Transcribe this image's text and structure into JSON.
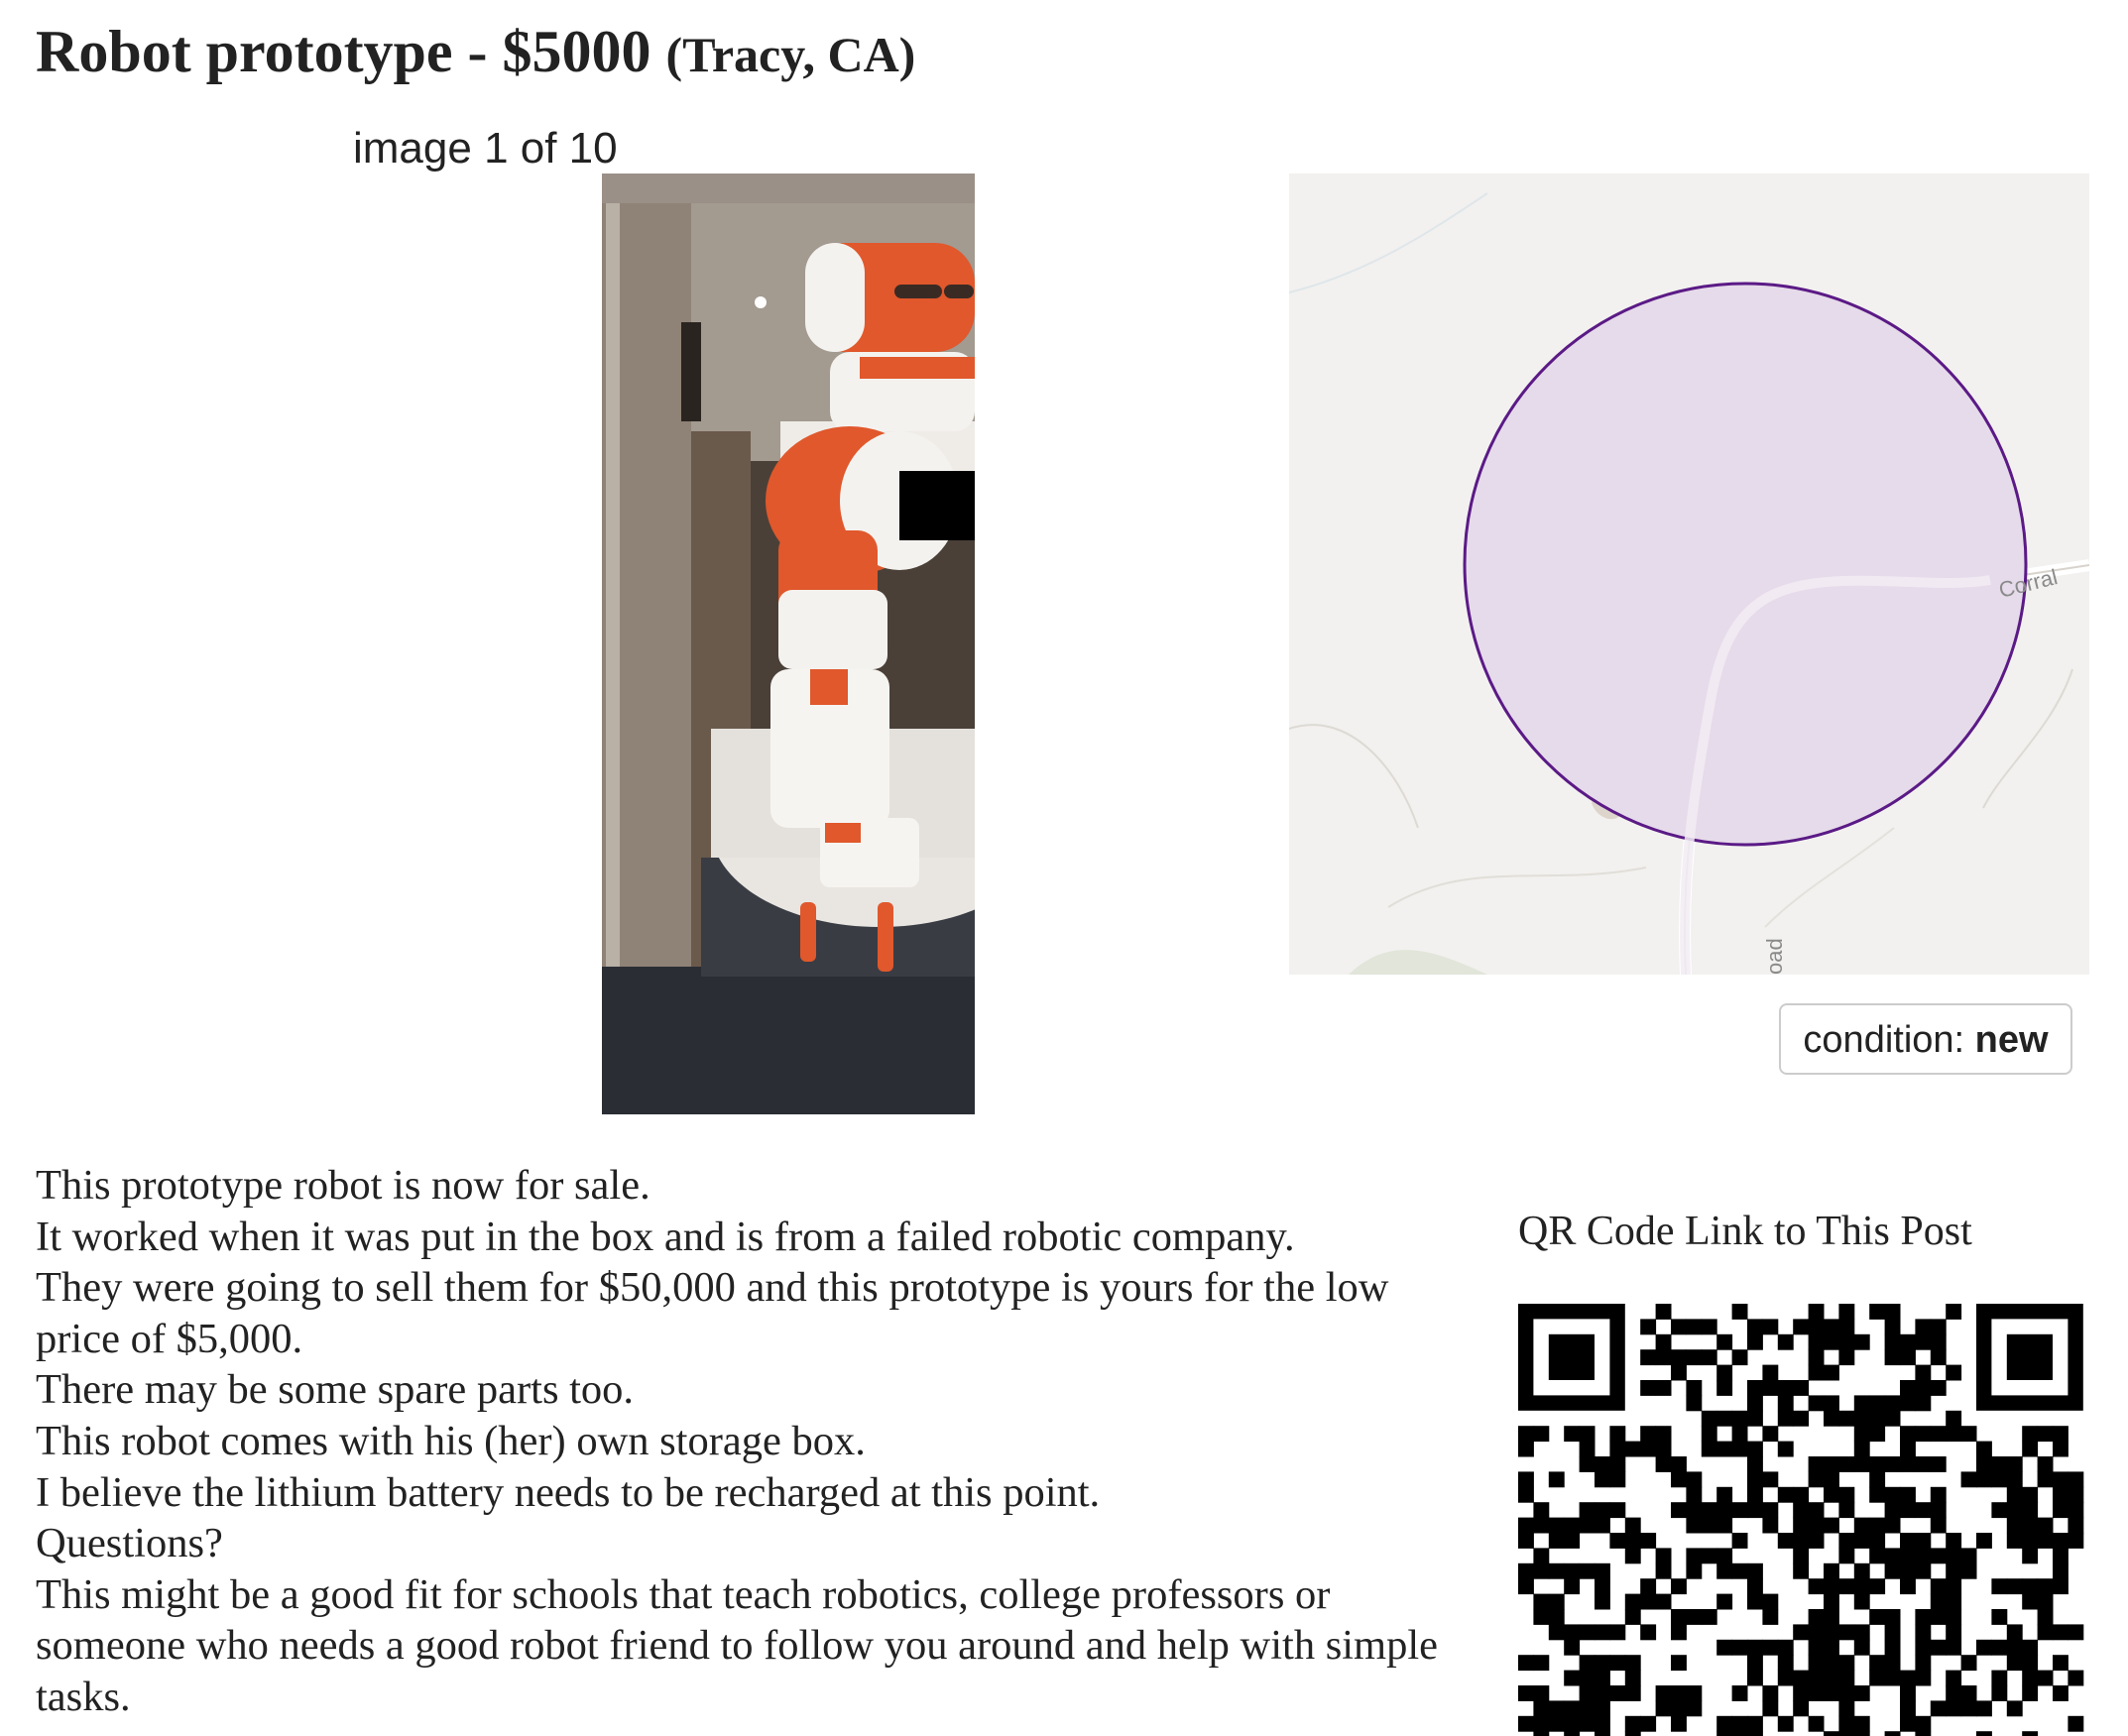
{
  "posting": {
    "title": "Robot prototype - $5000",
    "location": "(Tracy, CA)"
  },
  "gallery": {
    "counter": "image 1 of 10",
    "colors": {
      "robot_orange": "#e0582c",
      "robot_white": "#f4f2ef"
    }
  },
  "map": {
    "road_labels": [
      "Corral",
      "oad"
    ],
    "colors": {
      "background": "#f2f1ef",
      "circle_fill": "#e6dbea",
      "circle_stroke": "#5b1a86"
    }
  },
  "attributes": {
    "condition_label": "condition:",
    "condition_value": "new"
  },
  "description": {
    "lines": [
      "This prototype robot is now for sale.",
      "It worked when it was put in the box and is from a failed robotic company.",
      "They were going to sell them for $50,000 and this prototype is yours for the low price of $5,000.",
      "There may be some spare parts too.",
      "This robot comes with his (her) own storage box.",
      "I believe the lithium battery needs to be recharged at this point.",
      "Questions?",
      "This might be a good fit for schools that teach robotics, college professors or someone who needs a good robot friend to follow you around and help with simple tasks."
    ]
  },
  "qr": {
    "label": "QR Code Link to This Post"
  }
}
